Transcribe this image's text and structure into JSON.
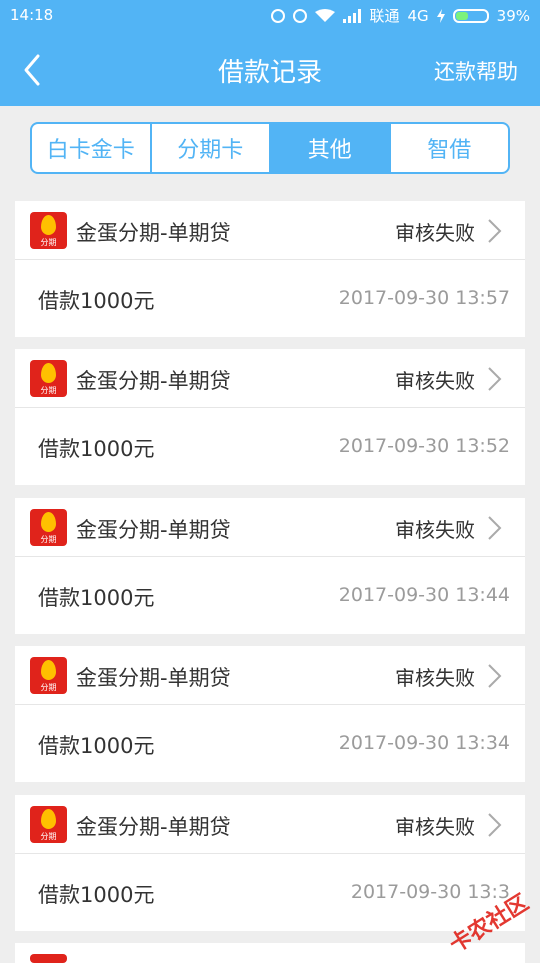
{
  "status_bar": {
    "time": "14:18",
    "carrier": "联通",
    "network": "4G",
    "battery": "39%",
    "battery_level": 0.39
  },
  "header": {
    "title": "借款记录",
    "help": "还款帮助"
  },
  "tabs": [
    {
      "label": "白卡金卡",
      "active": false
    },
    {
      "label": "分期卡",
      "active": false
    },
    {
      "label": "其他",
      "active": true
    },
    {
      "label": "智借",
      "active": false
    }
  ],
  "records": [
    {
      "logo_text": "分期",
      "product": "金蛋分期-单期贷",
      "status": "审核失败",
      "amount": "借款1000元",
      "time": "2017-09-30 13:57"
    },
    {
      "logo_text": "分期",
      "product": "金蛋分期-单期贷",
      "status": "审核失败",
      "amount": "借款1000元",
      "time": "2017-09-30 13:52"
    },
    {
      "logo_text": "分期",
      "product": "金蛋分期-单期贷",
      "status": "审核失败",
      "amount": "借款1000元",
      "time": "2017-09-30 13:44"
    },
    {
      "logo_text": "分期",
      "product": "金蛋分期-单期贷",
      "status": "审核失败",
      "amount": "借款1000元",
      "time": "2017-09-30 13:34"
    },
    {
      "logo_text": "分期",
      "product": "金蛋分期-单期贷",
      "status": "审核失败",
      "amount": "借款1000元",
      "time": "2017-09-30 13:3"
    }
  ],
  "watermark": "卡农社区",
  "colors": {
    "primary": "#52b4f5",
    "logo_red": "#e0231b",
    "egg_yellow": "#ffc000"
  }
}
